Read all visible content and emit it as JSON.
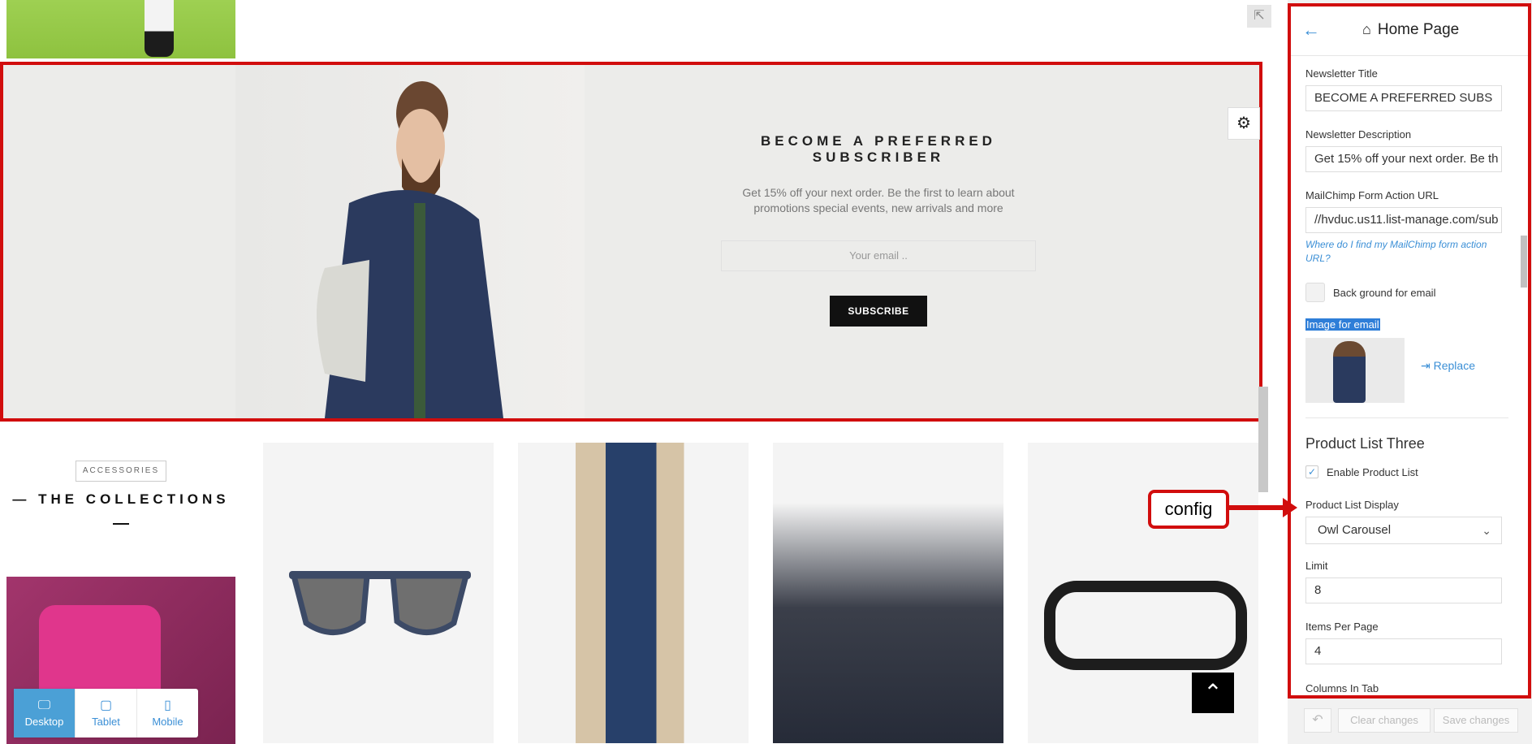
{
  "preview": {
    "newsletter": {
      "title": "BECOME A PREFERRED SUBSCRIBER",
      "description": "Get 15% off your next order. Be the first to learn about promotions special events, new arrivals and more",
      "email_placeholder": "Your email ..",
      "button_label": "SUBSCRIBE"
    },
    "collections": {
      "badge": "ACCESSORIES",
      "title": "— THE COLLECTIONS"
    },
    "devices": [
      {
        "label": "Desktop",
        "icon": "desktop-icon"
      },
      {
        "label": "Tablet",
        "icon": "tablet-icon"
      },
      {
        "label": "Mobile",
        "icon": "mobile-icon"
      }
    ],
    "callout": "config"
  },
  "panel": {
    "header_title": "Home Page",
    "newsletter_title_label": "Newsletter Title",
    "newsletter_title_value": "BECOME A PREFERRED SUBS",
    "newsletter_desc_label": "Newsletter Description",
    "newsletter_desc_value": "Get 15% off your next order. Be th",
    "mailchimp_label": "MailChimp Form Action URL",
    "mailchimp_value": "//hvduc.us11.list-manage.com/sub",
    "mailchimp_help": "Where do I find my MailChimp form action URL?",
    "bg_email_label": "Back ground for email",
    "image_label": "Image for email",
    "replace_label": "Replace",
    "section_title": "Product List Three",
    "enable_label": "Enable Product List",
    "display_label": "Product List Display",
    "display_value": "Owl Carousel",
    "limit_label": "Limit",
    "limit_value": "8",
    "items_per_page_label": "Items Per Page",
    "items_per_page_value": "4",
    "columns_label": "Columns In Tab"
  },
  "footer": {
    "clear_label": "Clear changes",
    "save_label": "Save changes"
  },
  "colors": {
    "highlight_border": "#d10d0d",
    "accent_blue": "#3b8fd6"
  }
}
